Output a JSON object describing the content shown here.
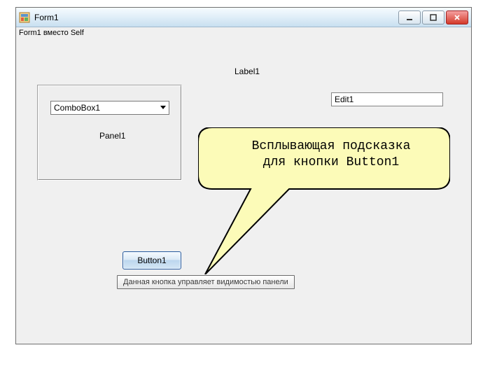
{
  "window": {
    "title": "Form1",
    "subheader": "Form1 вместо Self"
  },
  "labels": {
    "label1": "Label1",
    "panel1": "Panel1"
  },
  "controls": {
    "combo_text": "ComboBox1",
    "edit_value": "Edit1",
    "button1_label": "Button1"
  },
  "tooltip": {
    "text": "Данная кнопка управляет видимостью панели"
  },
  "callout": {
    "line1": "Всплывающая подсказка",
    "line2": "для кнопки Button1"
  }
}
